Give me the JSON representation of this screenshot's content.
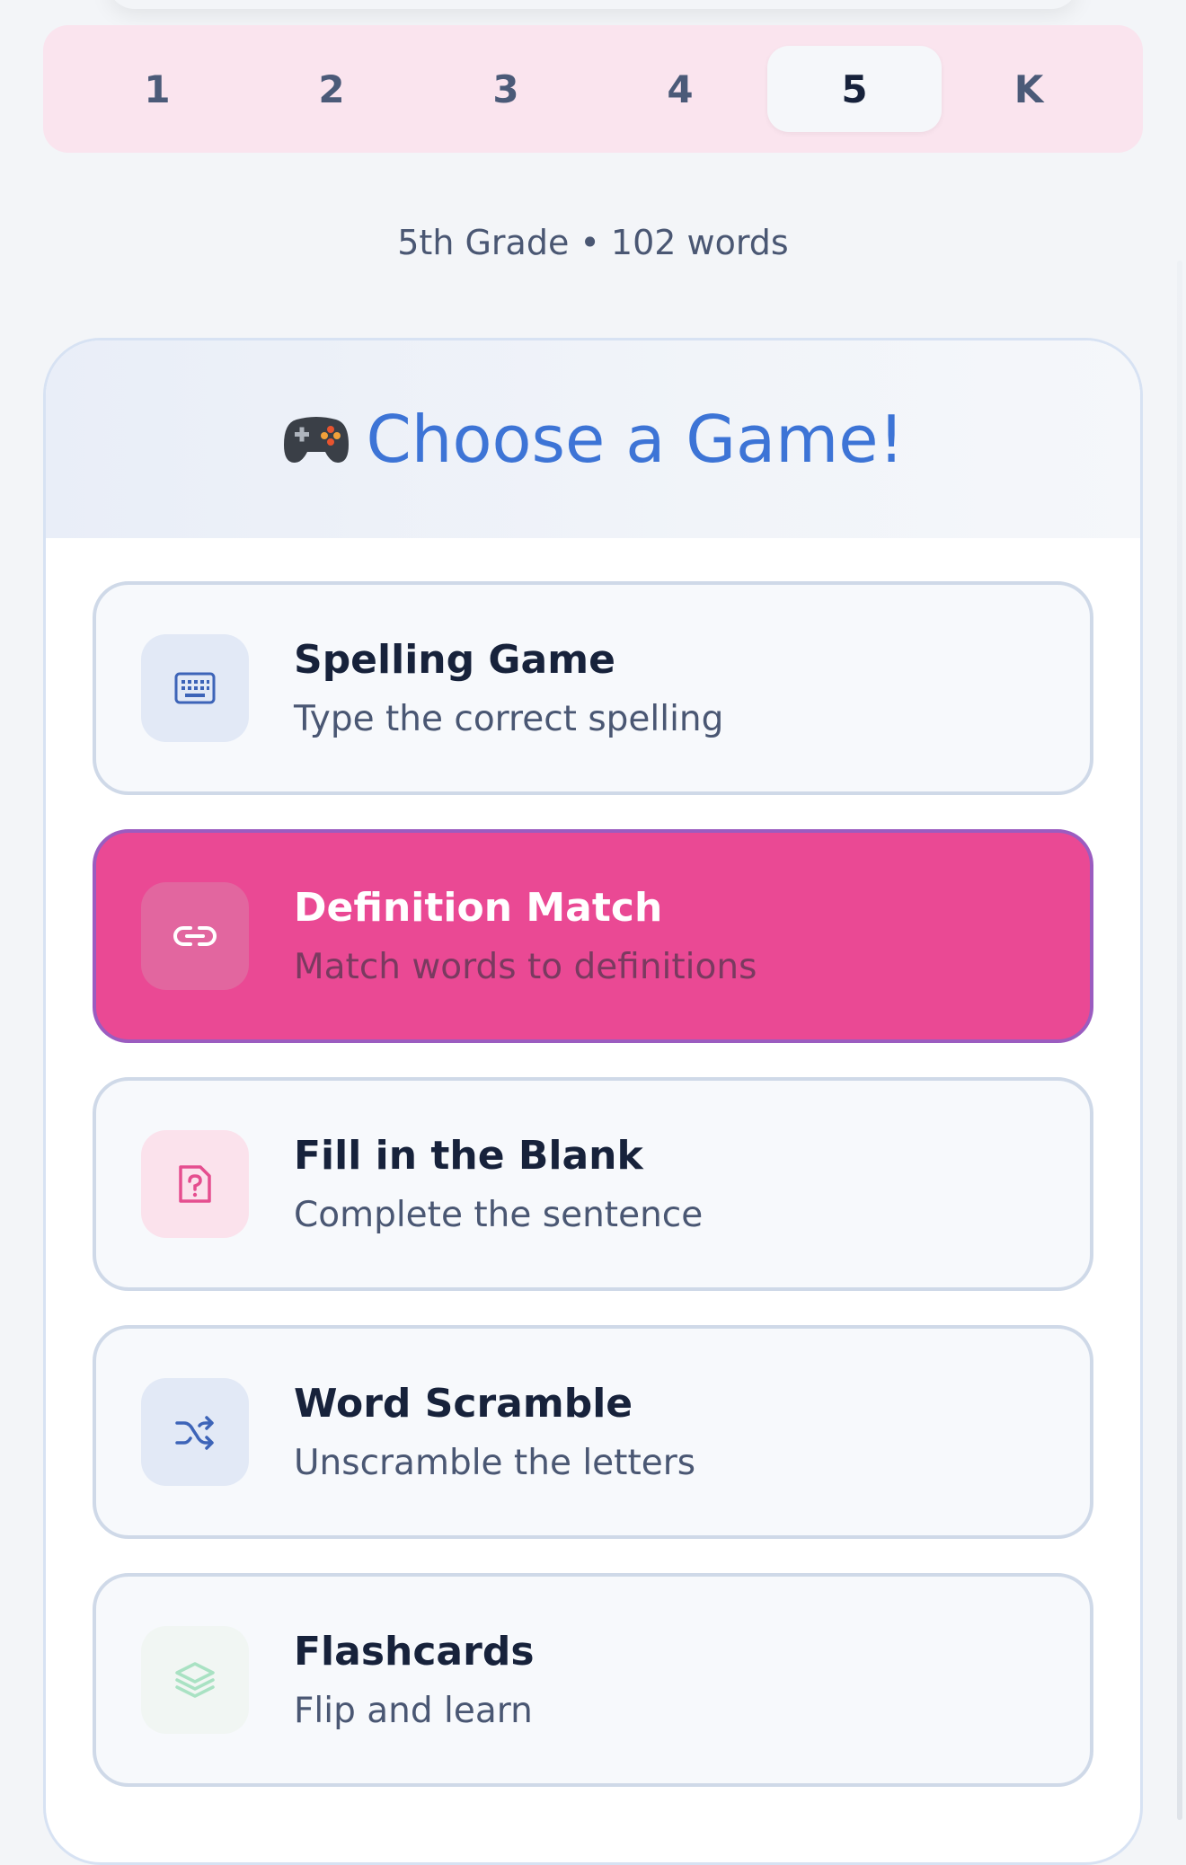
{
  "grade_tabs": [
    "1",
    "2",
    "3",
    "4",
    "5",
    "K"
  ],
  "selected_grade": "5",
  "grade_info": "5th Grade • 102 words",
  "header": {
    "icon": "game-controller-icon",
    "title": "Choose a Game!"
  },
  "games": [
    {
      "title": "Spelling Game",
      "subtitle": "Type the correct spelling",
      "icon": "keyboard-icon"
    },
    {
      "title": "Definition Match",
      "subtitle": "Match words to definitions",
      "icon": "link-icon"
    },
    {
      "title": "Fill in the Blank",
      "subtitle": "Complete the sentence",
      "icon": "question-file-icon"
    },
    {
      "title": "Word Scramble",
      "subtitle": "Unscramble the letters",
      "icon": "shuffle-icon"
    },
    {
      "title": "Flashcards",
      "subtitle": "Flip and learn",
      "icon": "layers-icon"
    }
  ],
  "selected_game": "Definition Match",
  "colors": {
    "accent_blue": "#3d74d6",
    "selected_pink": "#ea4994",
    "grade_bar_bg": "#fae4ee"
  }
}
